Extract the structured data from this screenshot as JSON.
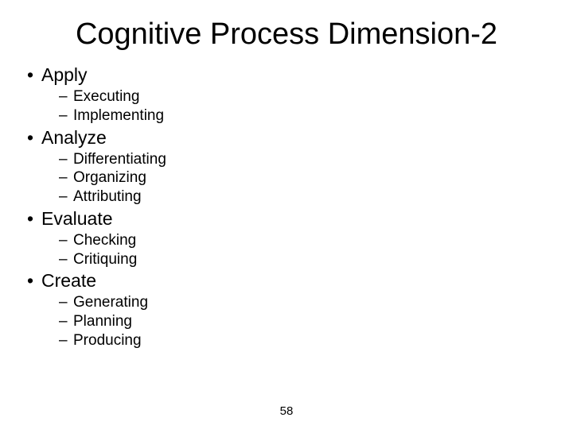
{
  "title": "Cognitive Process Dimension-2",
  "items": [
    {
      "label": "Apply",
      "subs": [
        "Executing",
        "Implementing"
      ]
    },
    {
      "label": "Analyze",
      "subs": [
        "Differentiating",
        "Organizing",
        "Attributing"
      ]
    },
    {
      "label": "Evaluate",
      "subs": [
        "Checking",
        "Critiquing"
      ]
    },
    {
      "label": "Create",
      "subs": [
        "Generating",
        "Planning",
        "Producing"
      ]
    }
  ],
  "page_number": "58"
}
